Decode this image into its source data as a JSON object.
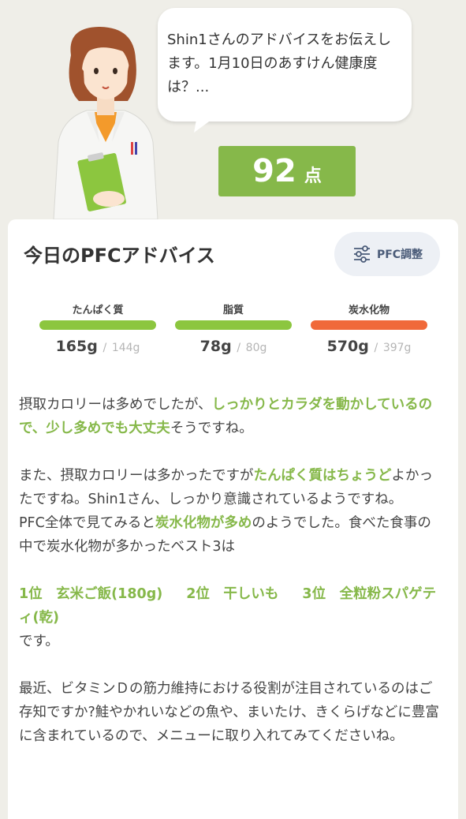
{
  "bubble": {
    "text": "Shin1さんのアドバイスをお伝えします。1月10日のあすけん健康度は？..."
  },
  "score": {
    "value": "92",
    "unit": "点"
  },
  "card": {
    "title": "今日のPFCアドバイス",
    "pfc_button_label": "PFC調整"
  },
  "nutrients": [
    {
      "label": "たんぱく質",
      "value": "165g",
      "target": "144g",
      "color": "#8cc63f"
    },
    {
      "label": "脂質",
      "value": "78g",
      "target": "80g",
      "color": "#8cc63f"
    },
    {
      "label": "炭水化物",
      "value": "570g",
      "target": "397g",
      "color": "#f0693a"
    }
  ],
  "separator": "/",
  "advice": {
    "p1_a": "摂取カロリーは多めでしたが、",
    "p1_hl": "しっかりとカラダを動かしているので、少し多めでも大丈夫",
    "p1_b": "そうですね。",
    "p2_a": "また、摂取カロリーは多かったですが",
    "p2_hl": "たんぱく質はちょうど",
    "p2_b": "よかったですね。Shin1さん、しっかり意識されているようですね。",
    "p3_a": "PFC全体で見てみると",
    "p3_hl": "炭水化物が多め",
    "p3_b": "のようでした。食べた食事の中で炭水化物が多かったベスト3は",
    "ranking": [
      "1位　玄米ご飯(180g)",
      "2位　干しいも",
      "3位　全粒粉スパゲティ(乾)"
    ],
    "p4": "です。",
    "p5": "最近、ビタミンＤの筋力維持における役割が注目されているのはご存知ですか?鮭やかれいなどの魚や、まいたけ、きくらげなどに豊富に含まれているので、メニューに取り入れてみてくださいね。"
  }
}
